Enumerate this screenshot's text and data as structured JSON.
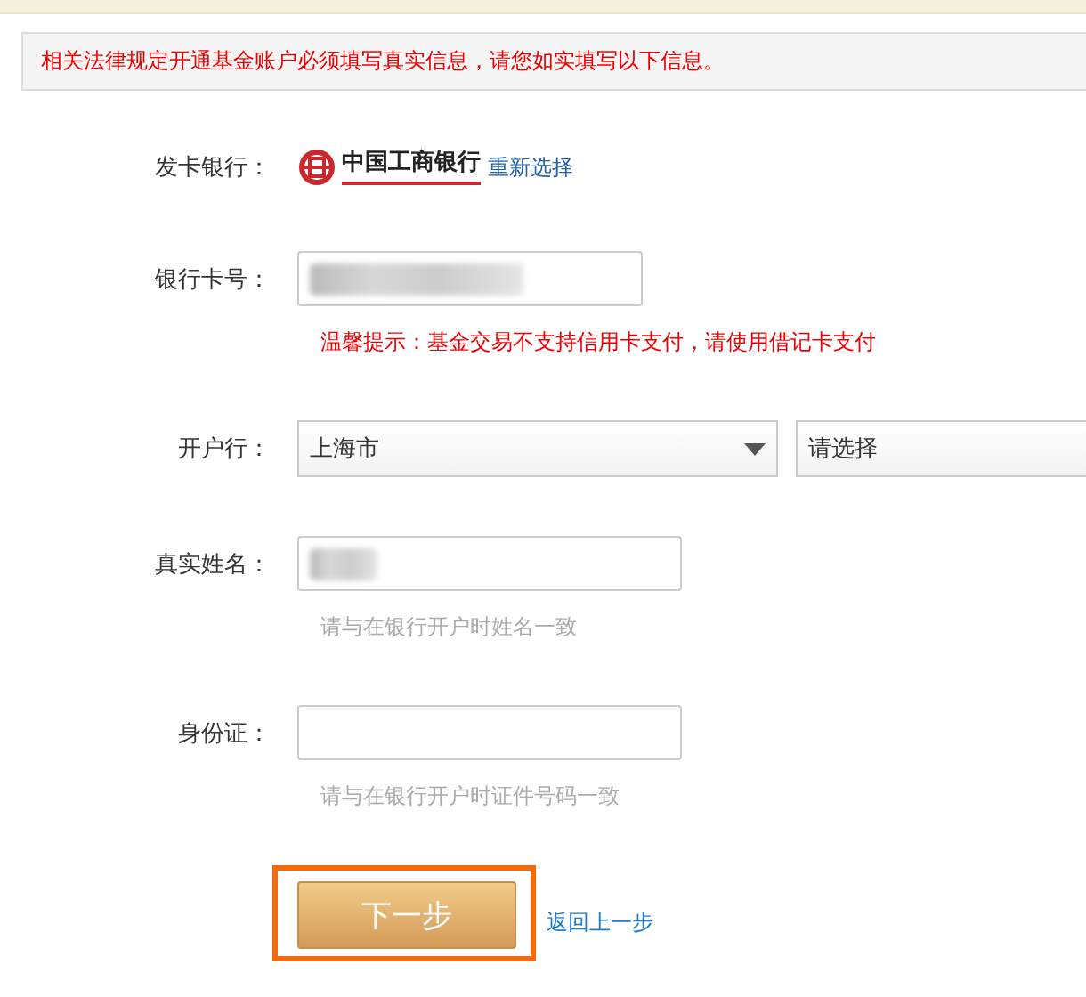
{
  "notice": "相关法律规定开通基金账户必须填写真实信息，请您如实填写以下信息。",
  "bank": {
    "label": "发卡银行：",
    "bank_name": "中国工商银行",
    "change_link": "重新选择"
  },
  "fields": [
    {
      "kind": "input",
      "label": "银行卡号：",
      "masked": true,
      "hint": "温馨提示：基金交易不支持信用卡支付，请使用借记卡支付",
      "hint_warning": true
    },
    {
      "kind": "selects",
      "label": "开户行：",
      "selects": [
        {
          "value": "上海市",
          "open_arrow": true
        },
        {
          "value": "请选择",
          "open_arrow": false
        }
      ]
    },
    {
      "kind": "input",
      "label": "真实姓名：",
      "masked": true,
      "hint": "请与在银行开户时姓名一致",
      "hint_warning": false
    },
    {
      "kind": "input",
      "label": "身份证：",
      "masked": false,
      "hint": "请与在银行开户时证件号码一致",
      "hint_warning": false
    }
  ],
  "next_button": {
    "label": "下一步",
    "focused": true
  },
  "back_link": "返回上一步"
}
